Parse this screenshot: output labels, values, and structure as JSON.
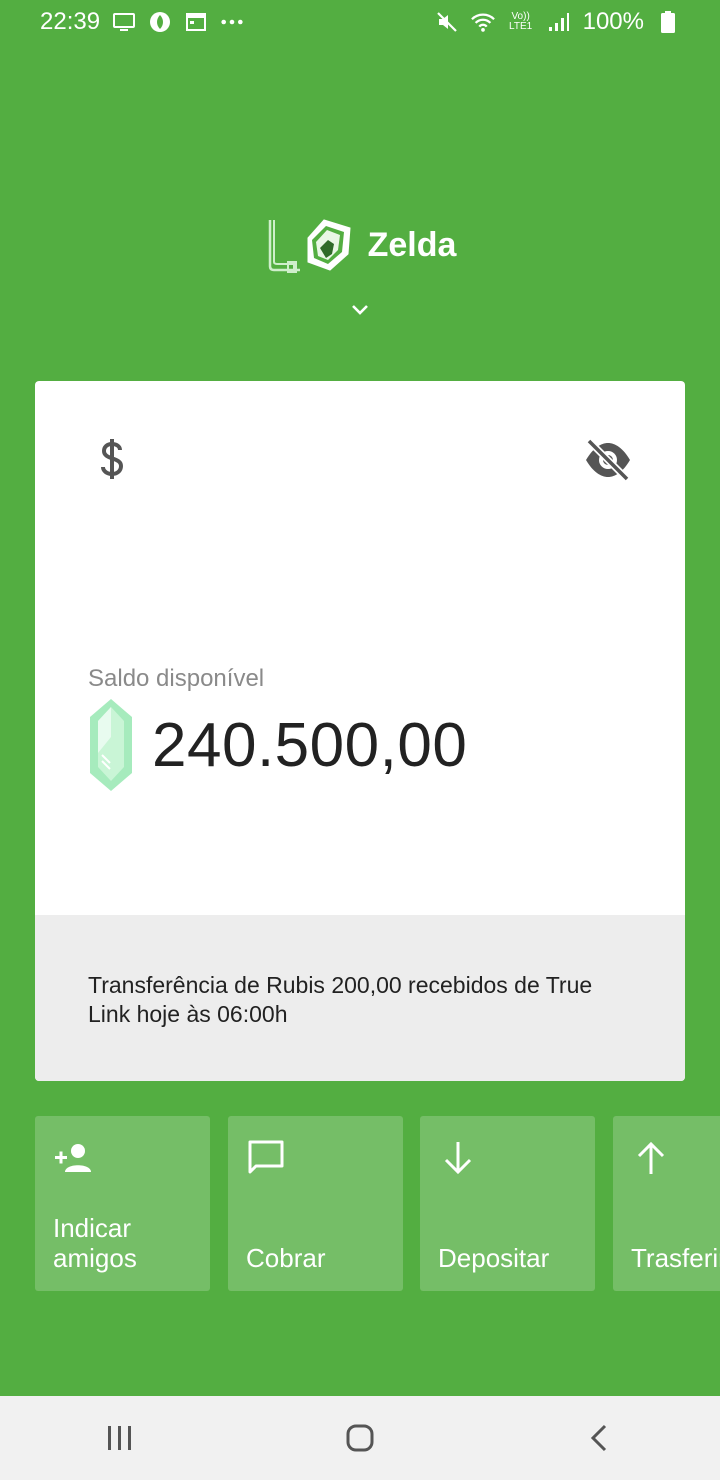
{
  "status_bar": {
    "time": "22:39",
    "battery": "100%",
    "left_icons": [
      "screen-icon",
      "leaf-icon",
      "calendar-icon",
      "more-dots-icon"
    ],
    "right_icons": [
      "mute-icon",
      "wifi-icon",
      "volte-icon",
      "signal-icon",
      "battery-icon"
    ],
    "volte_label": "Vo)) LTE1"
  },
  "header": {
    "brand_name": "Zelda"
  },
  "card": {
    "balance_label": "Saldo disponível",
    "balance_value": "240.500,00",
    "notification": "Transferência de Rubis 200,00 recebidos de True Link hoje às 06:00h"
  },
  "actions": [
    {
      "label": "Indicar amigos",
      "icon": "add-person-icon"
    },
    {
      "label": "Cobrar",
      "icon": "chat-icon"
    },
    {
      "label": "Depositar",
      "icon": "arrow-down-icon"
    },
    {
      "label": "Trasferir",
      "icon": "arrow-up-icon"
    }
  ],
  "colors": {
    "background": "#53ae41",
    "card": "#ffffff",
    "notice_bg": "#ededed",
    "rupee": "#9ee8b4"
  }
}
